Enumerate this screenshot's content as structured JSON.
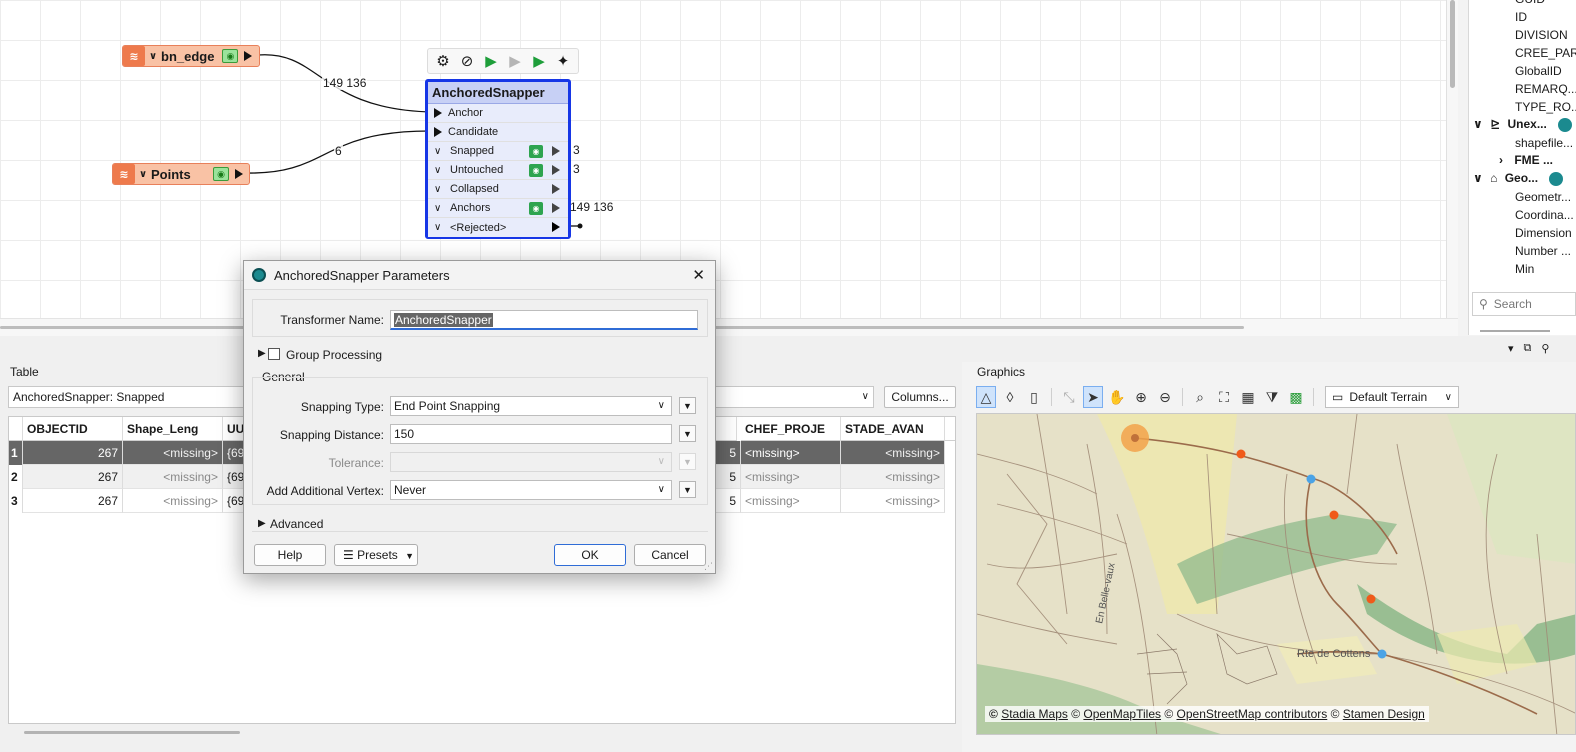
{
  "canvas": {
    "readers": [
      {
        "name": "bn_edge"
      },
      {
        "name": "Points"
      }
    ],
    "connections": {
      "edge_count": "149 136",
      "points_count": "6"
    },
    "transformer": {
      "name": "AnchoredSnapper",
      "ports": {
        "anchor": "Anchor",
        "candidate": "Candidate",
        "snapped": "Snapped",
        "untouched": "Untouched",
        "collapsed": "Collapsed",
        "anchors": "Anchors",
        "rejected": "<Rejected>"
      },
      "counts": {
        "snapped": "3",
        "untouched": "3",
        "anchors": "149 136"
      }
    }
  },
  "right_panel": {
    "items": [
      "GUID",
      "ID",
      "DIVISION",
      "CREE_PAR",
      "GlobalID",
      "REMARQ...",
      "TYPE_RO..."
    ],
    "group_unexposed": "Unex...",
    "shapefile": "shapefile...",
    "fme": "FME ...",
    "group_geometry": "Geo...",
    "geo_items": [
      "Geometr...",
      "Coordina...",
      "Dimension",
      "Number ...",
      "Min"
    ],
    "search_placeholder": "Search"
  },
  "table": {
    "title": "Table",
    "source": "AnchoredSnapper: Snapped",
    "columns_button": "Columns...",
    "headers": {
      "objectid": "OBJECTID",
      "shape_leng": "Shape_Leng",
      "uu": "UU",
      "chef": "CHEF_PROJE",
      "stade": "STADE_AVAN"
    },
    "rows": [
      {
        "num": "1",
        "objectid": "267",
        "shape_leng": "<missing>",
        "uu": "{69",
        "mid": "5",
        "chef": "<missing>",
        "stade": "<missing>"
      },
      {
        "num": "2",
        "objectid": "267",
        "shape_leng": "<missing>",
        "uu": "{69",
        "mid": "5",
        "chef": "<missing>",
        "stade": "<missing>"
      },
      {
        "num": "3",
        "objectid": "267",
        "shape_leng": "<missing>",
        "uu": "{69",
        "mid": "5",
        "chef": "<missing>",
        "stade": "<missing>"
      }
    ]
  },
  "graphics": {
    "title": "Graphics",
    "basemap": "Default Terrain",
    "road_label": "Rte de Cottens",
    "road_label2": "En Belle-vaux",
    "credits": [
      "Stadia Maps",
      "OpenMapTiles",
      "OpenStreetMap contributors",
      "Stamen Design"
    ],
    "copyright": "©"
  },
  "dialog": {
    "title": "AnchoredSnapper Parameters",
    "transformer_name_label": "Transformer Name:",
    "transformer_name_value": "AnchoredSnapper",
    "group_processing": "Group Processing",
    "general": "General",
    "snapping_type_label": "Snapping Type:",
    "snapping_type_value": "End Point Snapping",
    "snapping_distance_label": "Snapping Distance:",
    "snapping_distance_value": "150",
    "tolerance_label": "Tolerance:",
    "add_vertex_label": "Add Additional Vertex:",
    "add_vertex_value": "Never",
    "advanced": "Advanced",
    "help": "Help",
    "presets": "Presets",
    "ok": "OK",
    "cancel": "Cancel"
  },
  "colors": {
    "reader_fill": "#f9c2a5",
    "transformer_border": "#1636e6",
    "selection_row": "#666666"
  }
}
